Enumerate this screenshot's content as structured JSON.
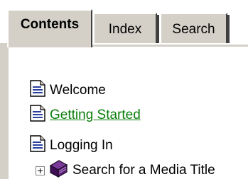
{
  "tabs": {
    "contents": "Contents",
    "index": "Index",
    "search": "Search"
  },
  "tree": {
    "items": [
      {
        "label": "Welcome",
        "icon": "document-icon"
      },
      {
        "label": "Getting Started",
        "icon": "document-icon",
        "style": "link"
      },
      {
        "label": "Logging In",
        "icon": "document-icon"
      },
      {
        "label": "Search for a Media Title",
        "icon": "book-icon",
        "expander": "plus"
      }
    ]
  },
  "colors": {
    "face": "#d4d0c8",
    "link": "#0a7d0a",
    "book": "#5a1f7a",
    "page_blue": "#2a3f9e"
  }
}
